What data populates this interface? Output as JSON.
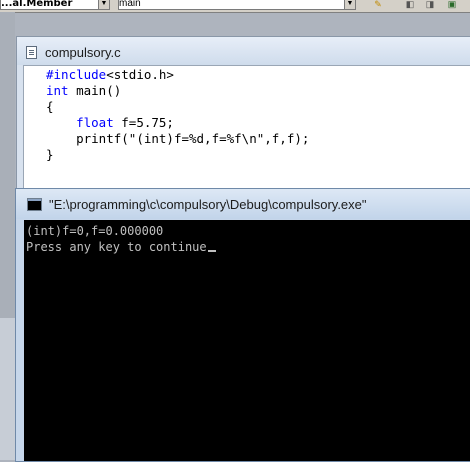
{
  "toolbar": {
    "combo_a_text": "...al.Member",
    "combo_b_text": "main",
    "icons": [
      "find-icon",
      "build-icon",
      "compile-icon"
    ]
  },
  "editor": {
    "title": "compulsory.c",
    "code": [
      {
        "kw": "#include",
        "rest": "<stdio.h>",
        "indent": ""
      },
      {
        "kw": "int",
        "rest": " main()",
        "indent": ""
      },
      {
        "kw": "",
        "rest": "{",
        "indent": ""
      },
      {
        "kw": "float",
        "rest": " f=5.75;",
        "indent": "    "
      },
      {
        "kw": "",
        "rest": "printf(\"(int)f=%d,f=%f\\n\",f,f);",
        "indent": "    "
      },
      {
        "kw": "",
        "rest": "}",
        "indent": ""
      }
    ],
    "colors": {
      "keyword": "#0000ff",
      "text": "#000000"
    }
  },
  "console": {
    "title": "\"E:\\programming\\c\\compulsory\\Debug\\compulsory.exe\"",
    "lines": [
      "(int)f=0,f=0.000000",
      "Press any key to continue"
    ],
    "colors": {
      "background": "#000000",
      "text": "#c0c0c0"
    }
  }
}
